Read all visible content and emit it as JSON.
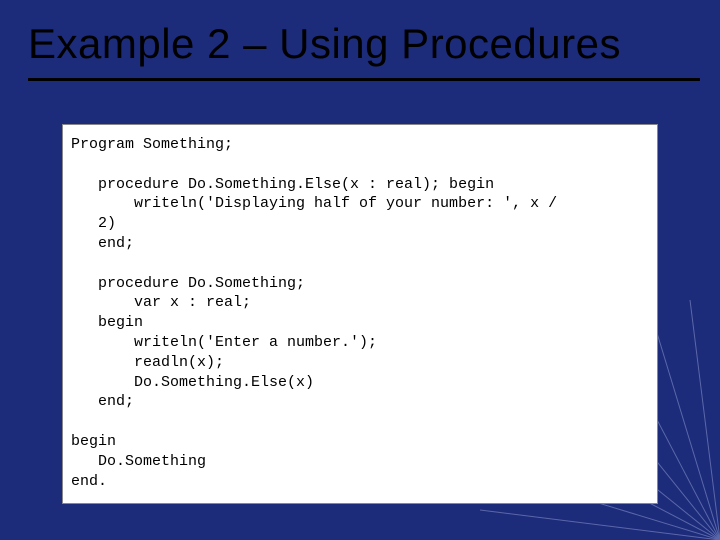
{
  "slide": {
    "title": "Example 2 – Using Procedures",
    "code": {
      "l01": "Program Something;",
      "l02": "",
      "l03": "   procedure Do.Something.Else(x : real); begin",
      "l04": "       writeln('Displaying half of your number: ', x /",
      "l05": "   2)",
      "l06": "   end;",
      "l07": "",
      "l08": "   procedure Do.Something;",
      "l09": "       var x : real;",
      "l10": "   begin",
      "l11": "       writeln('Enter a number.');",
      "l12": "       readln(x);",
      "l13": "       Do.Something.Else(x)",
      "l14": "   end;",
      "l15": "",
      "l16": "begin",
      "l17": "   Do.Something",
      "l18": "end."
    }
  }
}
